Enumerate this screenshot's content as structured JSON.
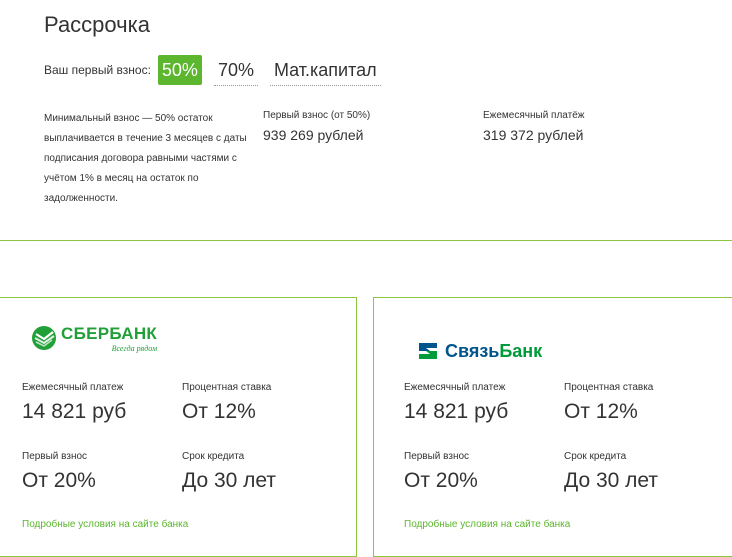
{
  "header": {
    "title": "Рассрочка"
  },
  "down_payment": {
    "label": "Ваш первый взнос:",
    "options": [
      "50%",
      "70%",
      "Мат.капитал"
    ],
    "selected": "50%"
  },
  "terms": {
    "description": "Минимальный взнос — 50% остаток выплачивается в течение 3 месяцев с даты подписания договора равными частями с учётом 1% в месяц на остаток по задолженности.",
    "first_payment_label": "Первый взнос (от 50%)",
    "first_payment_value": "939 269 рублей",
    "monthly_label": "Ежемесячный платёж",
    "monthly_value": "319 372 рублей"
  },
  "banks": [
    {
      "logo": {
        "name": "СБЕРБАНК",
        "tagline": "Всегда рядом",
        "icon": "sberbank-logo-icon",
        "color": "#21a038"
      },
      "monthly_label": "Ежемесячный платеж",
      "monthly_value": "14 821 руб",
      "rate_label": "Процентная ставка",
      "rate_value": "От 12%",
      "down_label": "Первый взнос",
      "down_value": "От 20%",
      "term_label": "Срок кредита",
      "term_value": "До 30 лет",
      "link": "Подробные условия на сайте банка"
    },
    {
      "logo": {
        "name_part1": "Связь",
        "name_part2": "Банк",
        "icon": "svyazbank-logo-icon",
        "color1": "#00558c",
        "color2": "#009b3a"
      },
      "monthly_label": "Ежемесячный платеж",
      "monthly_value": "14 821 руб",
      "rate_label": "Процентная ставка",
      "rate_value": "От 12%",
      "down_label": "Первый взнос",
      "down_value": "От 20%",
      "term_label": "Срок кредита",
      "term_value": "До 30 лет",
      "link": "Подробные условия на сайте банка"
    }
  ],
  "colors": {
    "accent": "#5cb62e",
    "border": "#8cc63f",
    "text": "#333333"
  }
}
